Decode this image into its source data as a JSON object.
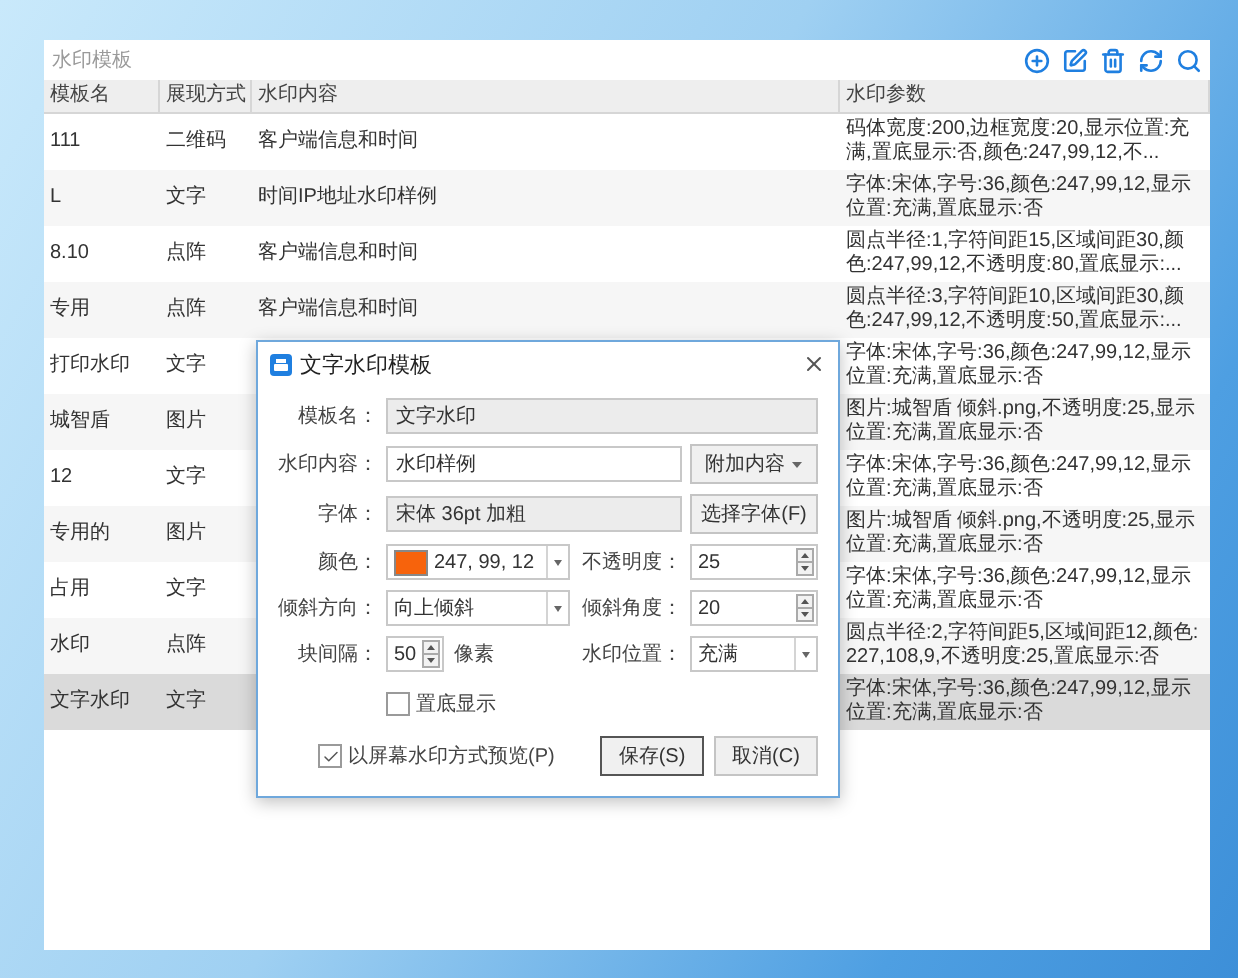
{
  "panel": {
    "title": "水印模板"
  },
  "table": {
    "columns": [
      "模板名",
      "展现方式",
      "水印内容",
      "水印参数"
    ],
    "rows": [
      {
        "name": "111",
        "mode": "二维码",
        "content": "客户端信息和时间",
        "params": "码体宽度:200,边框宽度:20,显示位置:充满,置底显示:否,颜色:247,99,12,不...",
        "selected": false
      },
      {
        "name": "L",
        "mode": "文字",
        "content": "时间IP地址水印样例",
        "params": "字体:宋体,字号:36,颜色:247,99,12,显示位置:充满,置底显示:否",
        "selected": false
      },
      {
        "name": "8.10",
        "mode": "点阵",
        "content": "客户端信息和时间",
        "params": "圆点半径:1,字符间距15,区域间距30,颜色:247,99,12,不透明度:80,置底显示:...",
        "selected": false
      },
      {
        "name": "专用",
        "mode": "点阵",
        "content": "客户端信息和时间",
        "params": "圆点半径:3,字符间距10,区域间距30,颜色:247,99,12,不透明度:50,置底显示:...",
        "selected": false
      },
      {
        "name": "打印水印",
        "mode": "文字",
        "params": "字体:宋体,字号:36,颜色:247,99,12,显示位置:充满,置底显示:否",
        "selected": false
      },
      {
        "name": "城智盾",
        "mode": "图片",
        "params": "图片:城智盾 倾斜.png,不透明度:25,显示位置:充满,置底显示:否",
        "selected": false
      },
      {
        "name": "12",
        "mode": "文字",
        "params": "字体:宋体,字号:36,颜色:247,99,12,显示位置:充满,置底显示:否",
        "selected": false
      },
      {
        "name": "专用的",
        "mode": "图片",
        "params": "图片:城智盾 倾斜.png,不透明度:25,显示位置:充满,置底显示:否",
        "selected": false
      },
      {
        "name": "占用",
        "mode": "文字",
        "params": "字体:宋体,字号:36,颜色:247,99,12,显示位置:充满,置底显示:否",
        "selected": false
      },
      {
        "name": "水印",
        "mode": "点阵",
        "params": "圆点半径:2,字符间距5,区域间距12,颜色:227,108,9,不透明度:25,置底显示:否",
        "selected": false
      },
      {
        "name": "文字水印",
        "mode": "文字",
        "params": "字体:宋体,字号:36,颜色:247,99,12,显示位置:充满,置底显示:否",
        "selected": true
      }
    ]
  },
  "dialog": {
    "title": "文字水印模板",
    "name_field": {
      "label": "模板名：",
      "value": "文字水印",
      "readonly": true
    },
    "content_field": {
      "label": "水印内容：",
      "value": "水印样例",
      "readonly": false
    },
    "append_button": {
      "label": "附加内容"
    },
    "font_field": {
      "label": "字体：",
      "value": "宋体 36pt 加粗",
      "readonly": true
    },
    "font_button": {
      "label": "选择字体(F)"
    },
    "color_field": {
      "label": "颜色：",
      "value": "247, 99, 12",
      "color": "#f7630c"
    },
    "opacity_field": {
      "label": "不透明度：",
      "value": "25"
    },
    "tilt_direction": {
      "label": "倾斜方向：",
      "value": "向上倾斜"
    },
    "tilt_angle": {
      "label": "倾斜角度：",
      "value": "20"
    },
    "spacing": {
      "label": "块间隔：",
      "value": "50",
      "unit": "像素"
    },
    "position": {
      "label": "水印位置：",
      "value": "充满"
    },
    "checkboxes": [
      {
        "label": "置底显示",
        "checked": false
      },
      {
        "label": "以屏幕水印方式预览(P)",
        "checked": true
      }
    ],
    "buttons": [
      {
        "label": "保存(S)",
        "default": true
      },
      {
        "label": "取消(C)",
        "default": false
      }
    ]
  }
}
